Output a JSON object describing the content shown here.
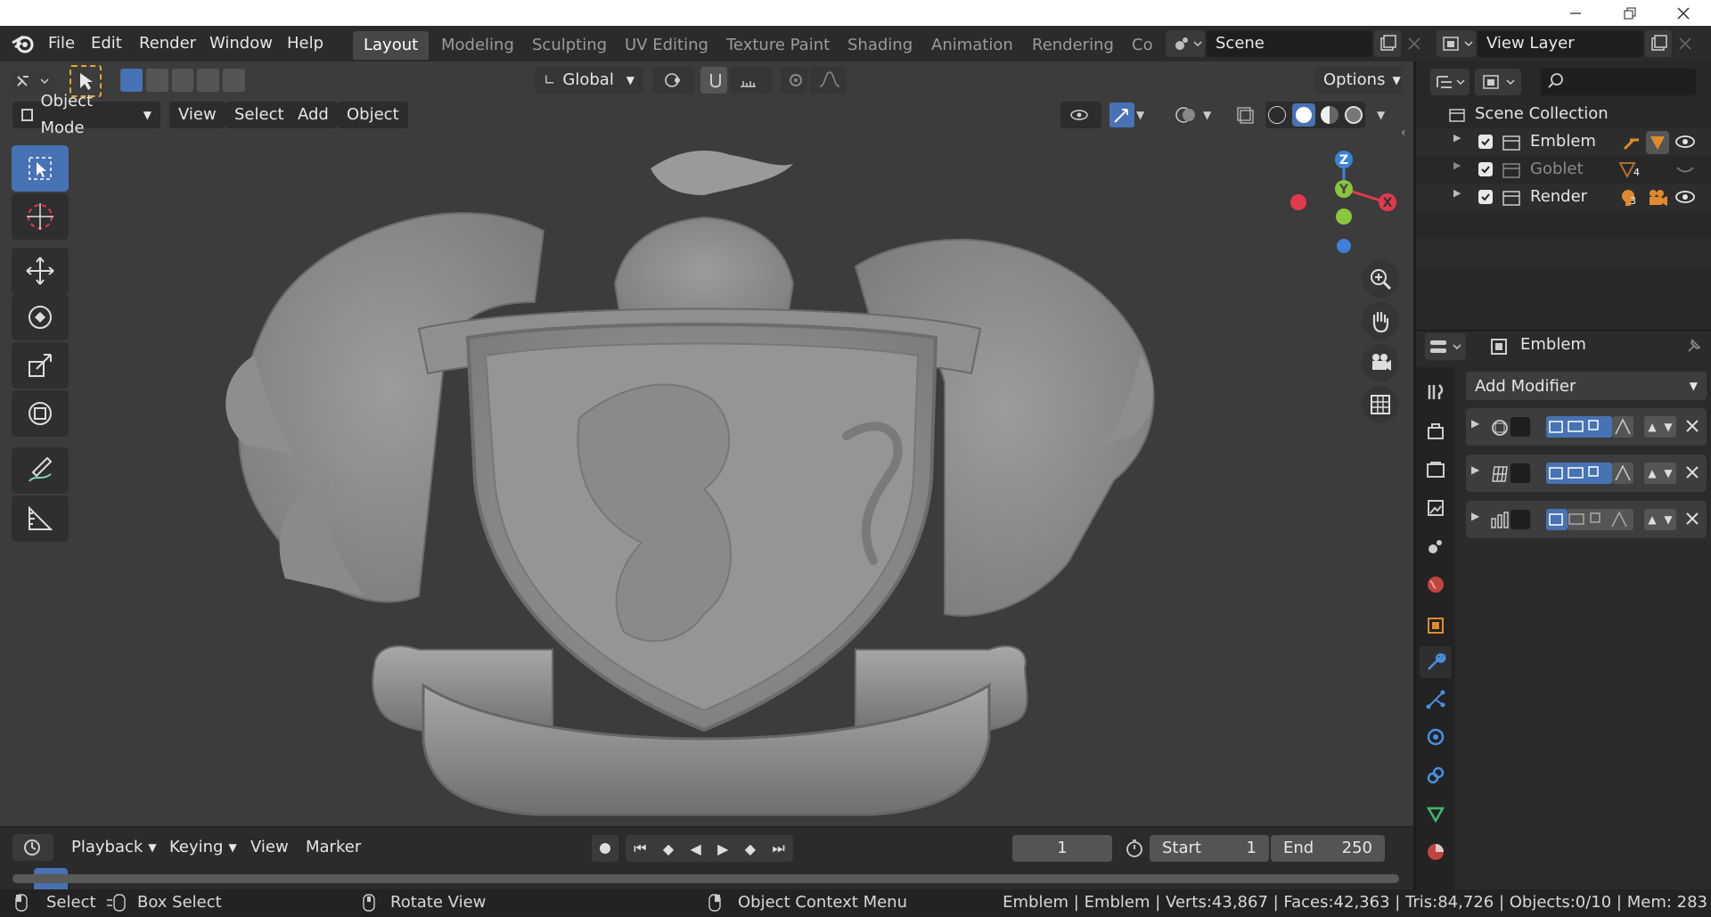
{
  "menus": [
    "File",
    "Edit",
    "Render",
    "Window",
    "Help"
  ],
  "workspaces": [
    "Layout",
    "Modeling",
    "Sculpting",
    "UV Editing",
    "Texture Paint",
    "Shading",
    "Animation",
    "Rendering",
    "Co"
  ],
  "active_workspace": "Layout",
  "scene_name": "Scene",
  "view_layer": "View Layer",
  "toolheader": {
    "orientation": "Global",
    "options": "Options"
  },
  "viewport_header": {
    "mode": "Object Mode",
    "view": "View",
    "select": "Select",
    "add": "Add",
    "object": "Object"
  },
  "gizmo": {
    "z": "Z",
    "y": "Y",
    "x": "X"
  },
  "timeline": {
    "playback": "Playback",
    "keying": "Keying",
    "view": "View",
    "marker": "Marker",
    "current_frame": "1",
    "start_label": "Start",
    "start": "1",
    "end_label": "End",
    "end": "250"
  },
  "status": {
    "select": "Select",
    "box_select": "Box Select",
    "rotate_view": "Rotate View",
    "context_menu": "Object Context Menu",
    "stats": "Emblem | Emblem | Verts:43,867 | Faces:42,363 | Tris:84,726 | Objects:0/10 | Mem: 283"
  },
  "outliner": {
    "root": "Scene Collection",
    "items": [
      {
        "name": "Emblem",
        "dim": false
      },
      {
        "name": "Goblet",
        "dim": true,
        "badge": "4"
      },
      {
        "name": "Render",
        "dim": false,
        "badge": "3"
      }
    ]
  },
  "properties": {
    "object_name": "Emblem",
    "add_modifier": "Add Modifier"
  },
  "colors": {
    "accent": "#4772b3",
    "x_axis": "#e2394c",
    "y_axis": "#8bc53f",
    "z_axis": "#3e82d8",
    "orange": "#e08a2f"
  }
}
